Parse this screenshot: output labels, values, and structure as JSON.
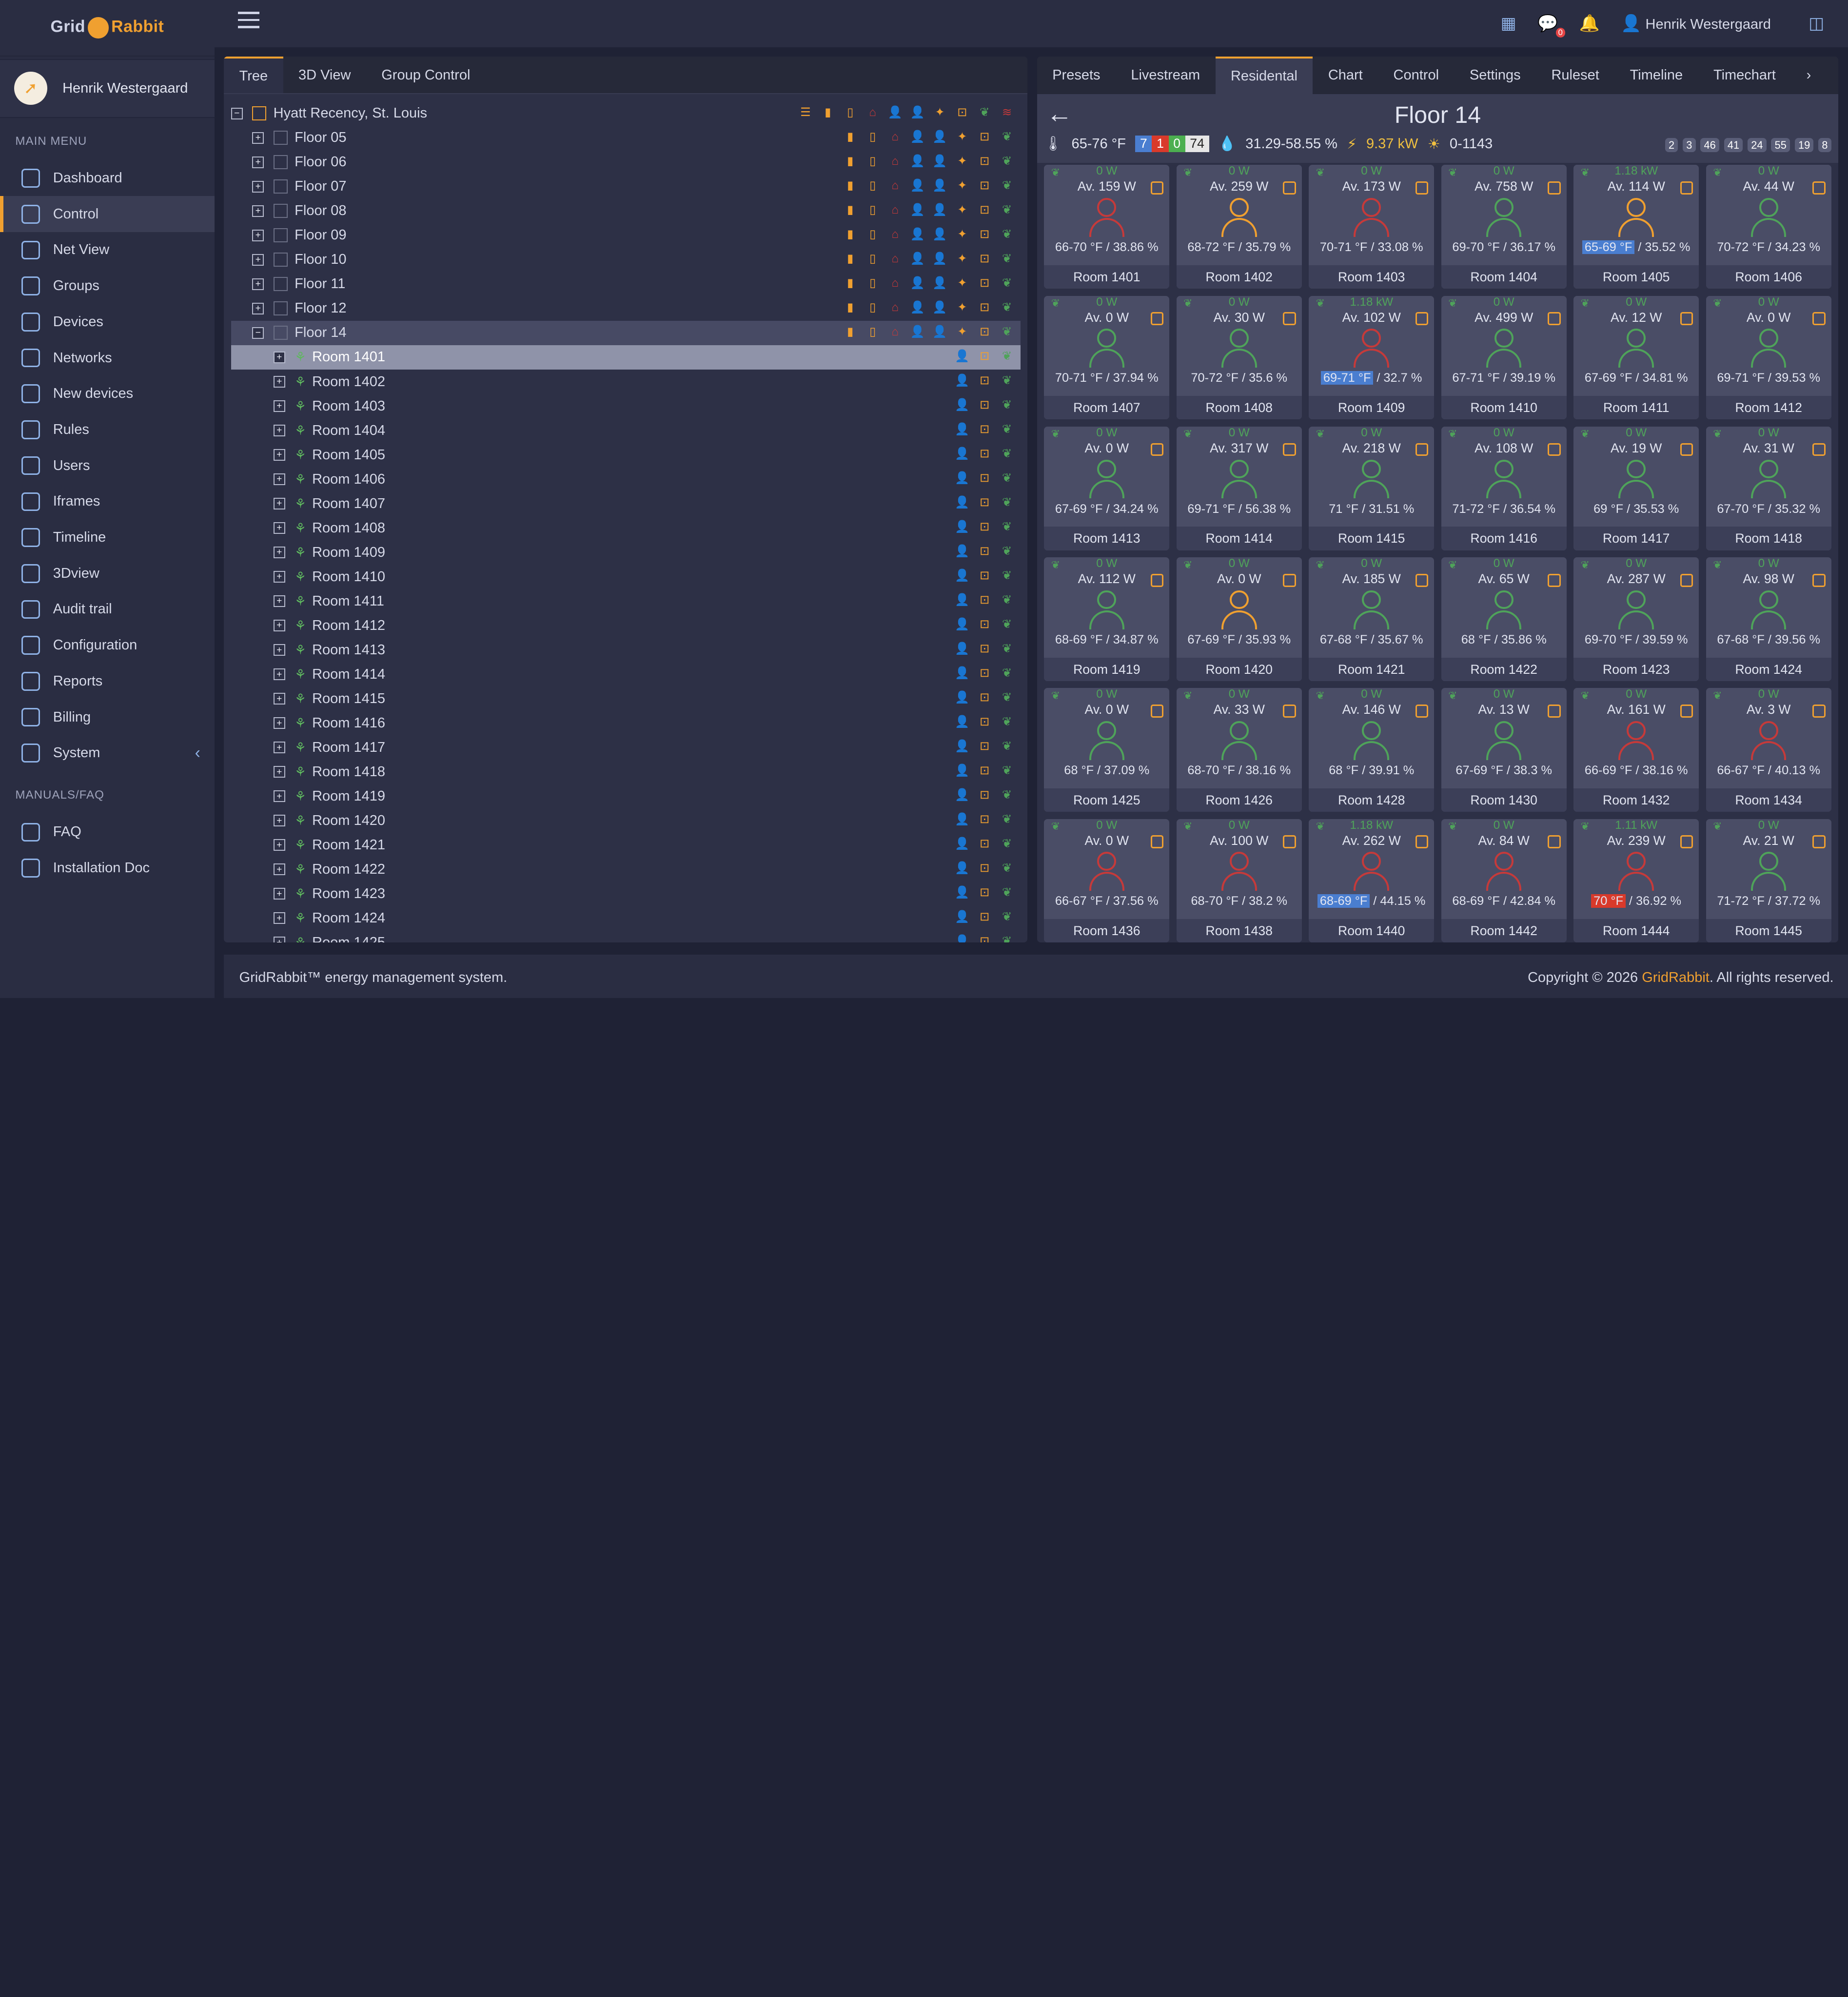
{
  "app": {
    "logo_grid": "Grid",
    "logo_rabbit": "Rabbit",
    "user_name": "Henrik Westergaard"
  },
  "sidebar": {
    "main_menu_title": "MAIN MENU",
    "manuals_title": "MANUALS/FAQ",
    "items": [
      {
        "label": "Dashboard",
        "icon": "dashboard-icon"
      },
      {
        "label": "Control",
        "icon": "checkbox-icon"
      },
      {
        "label": "Net View",
        "icon": "network-icon"
      },
      {
        "label": "Groups",
        "icon": "groups-icon"
      },
      {
        "label": "Devices",
        "icon": "monitor-icon"
      },
      {
        "label": "Networks",
        "icon": "networks-icon"
      },
      {
        "label": "New devices",
        "icon": "new-devices-icon"
      },
      {
        "label": "Rules",
        "icon": "sliders-icon"
      },
      {
        "label": "Users",
        "icon": "user-icon"
      },
      {
        "label": "Iframes",
        "icon": "external-link-icon"
      },
      {
        "label": "Timeline",
        "icon": "calendar-icon"
      },
      {
        "label": "3Dview",
        "icon": "cubes-icon"
      },
      {
        "label": "Audit trail",
        "icon": "history-icon"
      },
      {
        "label": "Configuration",
        "icon": "gear-icon"
      },
      {
        "label": "Reports",
        "icon": "report-icon"
      },
      {
        "label": "Billing",
        "icon": "dollar-icon"
      },
      {
        "label": "System",
        "icon": "wrench-icon"
      }
    ],
    "manuals": [
      {
        "label": "FAQ",
        "icon": "document-icon"
      },
      {
        "label": "Installation Doc",
        "icon": "document-icon"
      }
    ]
  },
  "topbar": {
    "user_name": "Henrik Westergaard",
    "chat_badge": "0"
  },
  "left_tabs": [
    "Tree",
    "3D View",
    "Group Control"
  ],
  "tree": {
    "root": "Hyatt Recency, St. Louis",
    "floors": [
      "Floor 05",
      "Floor 06",
      "Floor 07",
      "Floor 08",
      "Floor 09",
      "Floor 10",
      "Floor 11",
      "Floor 12",
      "Floor 14"
    ],
    "rooms": [
      "Room 1401",
      "Room 1402",
      "Room 1403",
      "Room 1404",
      "Room 1405",
      "Room 1406",
      "Room 1407",
      "Room 1408",
      "Room 1409",
      "Room 1410",
      "Room 1411",
      "Room 1412",
      "Room 1413",
      "Room 1414",
      "Room 1415",
      "Room 1416",
      "Room 1417",
      "Room 1418",
      "Room 1419",
      "Room 1420",
      "Room 1421",
      "Room 1422",
      "Room 1423",
      "Room 1424",
      "Room 1425"
    ]
  },
  "right_tabs": [
    "Presets",
    "Livestream",
    "Residental",
    "Chart",
    "Control",
    "Settings",
    "Ruleset",
    "Timeline",
    "Timechart"
  ],
  "floor": {
    "title": "Floor 14",
    "temp_range": "65-76 °F",
    "counts": [
      "7",
      "1",
      "0",
      "74"
    ],
    "humidity": "31.29-58.55 %",
    "power": "9.37 kW",
    "light": "0-1143",
    "badges": [
      "2",
      "3",
      "46",
      "41",
      "24",
      "55",
      "19",
      "8"
    ]
  },
  "rooms": [
    {
      "pw": "0 W",
      "av": "Av. 159 W",
      "climate": "66-70 °F / 38.86 %",
      "name": "Room 1401",
      "occ": "r"
    },
    {
      "pw": "0 W",
      "av": "Av. 259 W",
      "climate": "68-72 °F / 35.79 %",
      "name": "Room 1402",
      "occ": "o"
    },
    {
      "pw": "0 W",
      "av": "Av. 173 W",
      "climate": "70-71 °F / 33.08 %",
      "name": "Room 1403",
      "occ": "r"
    },
    {
      "pw": "0 W",
      "av": "Av. 758 W",
      "climate": "69-70 °F / 36.17 %",
      "name": "Room 1404",
      "occ": "g"
    },
    {
      "pw": "1.18 kW",
      "av": "Av. 114 W",
      "climate_hl": "65-69 °F",
      "climate_rest": " / 35.52 %",
      "name": "Room 1405",
      "occ": "o",
      "hl": "b"
    },
    {
      "pw": "0 W",
      "av": "Av. 44 W",
      "climate": "70-72 °F / 34.23 %",
      "name": "Room 1406",
      "occ": "g"
    },
    {
      "pw": "0 W",
      "av": "Av. 0 W",
      "climate": "70-71 °F / 37.94 %",
      "name": "Room 1407",
      "occ": "g"
    },
    {
      "pw": "0 W",
      "av": "Av. 30 W",
      "climate": "70-72 °F / 35.6 %",
      "name": "Room 1408",
      "occ": "g"
    },
    {
      "pw": "1.18 kW",
      "av": "Av. 102 W",
      "climate_hl": "69-71 °F",
      "climate_rest": " / 32.7 %",
      "name": "Room 1409",
      "occ": "r",
      "hl": "b"
    },
    {
      "pw": "0 W",
      "av": "Av. 499 W",
      "climate": "67-71 °F / 39.19 %",
      "name": "Room 1410",
      "occ": "g"
    },
    {
      "pw": "0 W",
      "av": "Av. 12 W",
      "climate": "67-69 °F / 34.81 %",
      "name": "Room 1411",
      "occ": "g"
    },
    {
      "pw": "0 W",
      "av": "Av. 0 W",
      "climate": "69-71 °F / 39.53 %",
      "name": "Room 1412",
      "occ": "g"
    },
    {
      "pw": "0 W",
      "av": "Av. 0 W",
      "climate": "67-69 °F / 34.24 %",
      "name": "Room 1413",
      "occ": "g"
    },
    {
      "pw": "0 W",
      "av": "Av. 317 W",
      "climate": "69-71 °F / 56.38 %",
      "name": "Room 1414",
      "occ": "g"
    },
    {
      "pw": "0 W",
      "av": "Av. 218 W",
      "climate": "71 °F / 31.51 %",
      "name": "Room 1415",
      "occ": "g"
    },
    {
      "pw": "0 W",
      "av": "Av. 108 W",
      "climate": "71-72 °F / 36.54 %",
      "name": "Room 1416",
      "occ": "g"
    },
    {
      "pw": "0 W",
      "av": "Av. 19 W",
      "climate": "69 °F / 35.53 %",
      "name": "Room 1417",
      "occ": "g"
    },
    {
      "pw": "0 W",
      "av": "Av. 31 W",
      "climate": "67-70 °F / 35.32 %",
      "name": "Room 1418",
      "occ": "g"
    },
    {
      "pw": "0 W",
      "av": "Av. 112 W",
      "climate": "68-69 °F / 34.87 %",
      "name": "Room 1419",
      "occ": "g"
    },
    {
      "pw": "0 W",
      "av": "Av. 0 W",
      "climate": "67-69 °F / 35.93 %",
      "name": "Room 1420",
      "occ": "o"
    },
    {
      "pw": "0 W",
      "av": "Av. 185 W",
      "climate": "67-68 °F / 35.67 %",
      "name": "Room 1421",
      "occ": "g"
    },
    {
      "pw": "0 W",
      "av": "Av. 65 W",
      "climate": "68 °F / 35.86 %",
      "name": "Room 1422",
      "occ": "g"
    },
    {
      "pw": "0 W",
      "av": "Av. 287 W",
      "climate": "69-70 °F / 39.59 %",
      "name": "Room 1423",
      "occ": "g"
    },
    {
      "pw": "0 W",
      "av": "Av. 98 W",
      "climate": "67-68 °F / 39.56 %",
      "name": "Room 1424",
      "occ": "g"
    },
    {
      "pw": "0 W",
      "av": "Av. 0 W",
      "climate": "68 °F / 37.09 %",
      "name": "Room 1425",
      "occ": "g"
    },
    {
      "pw": "0 W",
      "av": "Av. 33 W",
      "climate": "68-70 °F / 38.16 %",
      "name": "Room 1426",
      "occ": "g"
    },
    {
      "pw": "0 W",
      "av": "Av. 146 W",
      "climate": "68 °F / 39.91 %",
      "name": "Room 1428",
      "occ": "g"
    },
    {
      "pw": "0 W",
      "av": "Av. 13 W",
      "climate": "67-69 °F / 38.3 %",
      "name": "Room 1430",
      "occ": "g"
    },
    {
      "pw": "0 W",
      "av": "Av. 161 W",
      "climate": "66-69 °F / 38.16 %",
      "name": "Room 1432",
      "occ": "r"
    },
    {
      "pw": "0 W",
      "av": "Av. 3 W",
      "climate": "66-67 °F / 40.13 %",
      "name": "Room 1434",
      "occ": "r"
    },
    {
      "pw": "0 W",
      "av": "Av. 0 W",
      "climate": "66-67 °F / 37.56 %",
      "name": "Room 1436",
      "occ": "r"
    },
    {
      "pw": "0 W",
      "av": "Av. 100 W",
      "climate": "68-70 °F / 38.2 %",
      "name": "Room 1438",
      "occ": "r"
    },
    {
      "pw": "1.18 kW",
      "av": "Av. 262 W",
      "climate_hl": "68-69 °F",
      "climate_rest": " / 44.15 %",
      "name": "Room 1440",
      "occ": "r",
      "hl": "b"
    },
    {
      "pw": "0 W",
      "av": "Av. 84 W",
      "climate": "68-69 °F / 42.84 %",
      "name": "Room 1442",
      "occ": "r"
    },
    {
      "pw": "1.11 kW",
      "av": "Av. 239 W",
      "climate_hl": "70 °F",
      "climate_rest": " / 36.92 %",
      "name": "Room 1444",
      "occ": "r",
      "hl": "r"
    },
    {
      "pw": "0 W",
      "av": "Av. 21 W",
      "climate": "71-72 °F / 37.72 %",
      "name": "Room 1445",
      "occ": "g"
    }
  ],
  "footer": {
    "left": "GridRabbit™ energy management system.",
    "right_prefix": "Copyright © 2026 ",
    "brand": "GridRabbit",
    "right_suffix": ". All rights reserved."
  }
}
